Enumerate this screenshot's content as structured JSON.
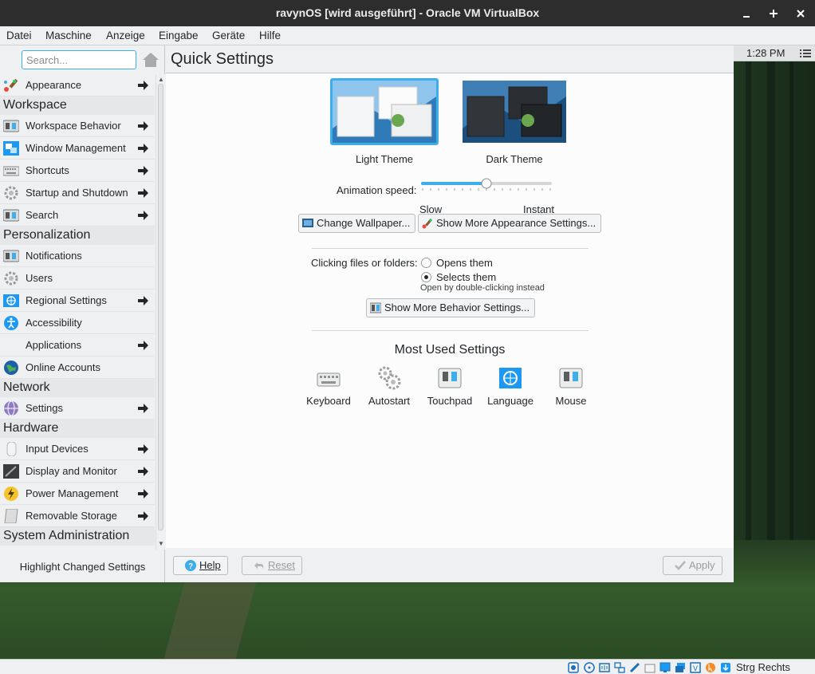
{
  "window": {
    "title": "ravynOS [wird ausgeführt] - Oracle VM VirtualBox",
    "controls": [
      "minimize-icon",
      "maximize-icon",
      "close-icon"
    ]
  },
  "menubar": [
    "Datei",
    "Maschine",
    "Anzeige",
    "Eingabe",
    "Geräte",
    "Hilfe"
  ],
  "panel": {
    "clock": "1:28 PM"
  },
  "sidebar": {
    "search_placeholder": "Search...",
    "items": [
      {
        "label": "Appearance",
        "icon": "appearance-icon",
        "arrow": true
      },
      {
        "header": "Workspace"
      },
      {
        "label": "Workspace Behavior",
        "icon": "workspace-behavior-icon",
        "arrow": true
      },
      {
        "label": "Window Management",
        "icon": "window-management-icon",
        "arrow": true
      },
      {
        "label": "Shortcuts",
        "icon": "keyboard-icon",
        "arrow": true
      },
      {
        "label": "Startup and Shutdown",
        "icon": "gear-icon",
        "arrow": true
      },
      {
        "label": "Search",
        "icon": "search-settings-icon",
        "arrow": true
      },
      {
        "header": "Personalization"
      },
      {
        "label": "Notifications",
        "icon": "notifications-icon",
        "arrow": false
      },
      {
        "label": "Users",
        "icon": "gear-icon",
        "arrow": false
      },
      {
        "label": "Regional Settings",
        "icon": "regional-icon",
        "arrow": true
      },
      {
        "label": "Accessibility",
        "icon": "accessibility-icon",
        "arrow": false
      },
      {
        "label": "Applications",
        "icon": "",
        "arrow": true
      },
      {
        "label": "Online Accounts",
        "icon": "globe-icon",
        "arrow": false
      },
      {
        "header": "Network"
      },
      {
        "label": "Settings",
        "icon": "network-settings-icon",
        "arrow": true
      },
      {
        "header": "Hardware"
      },
      {
        "label": "Input Devices",
        "icon": "mouse-icon",
        "arrow": true
      },
      {
        "label": "Display and Monitor",
        "icon": "monitor-icon",
        "arrow": true
      },
      {
        "label": "Power Management",
        "icon": "power-icon",
        "arrow": true
      },
      {
        "label": "Removable Storage",
        "icon": "storage-icon",
        "arrow": true
      },
      {
        "header": "System Administration"
      }
    ],
    "highlight_label": "Highlight Changed Settings"
  },
  "main": {
    "title": "Quick Settings",
    "themes": [
      {
        "label": "Light Theme",
        "selected": true
      },
      {
        "label": "Dark Theme",
        "selected": false
      }
    ],
    "animation": {
      "label": "Animation speed:",
      "slow": "Slow",
      "instant": "Instant",
      "level": 0.5
    },
    "change_wallpaper": "Change Wallpaper...",
    "more_appearance": "Show More Appearance Settings...",
    "clicking_label": "Clicking files or folders:",
    "radio_opens": "Opens them",
    "radio_selects": "Selects them",
    "radio_selected": "selects",
    "hint": "Open by double-clicking instead",
    "more_behavior": "Show More Behavior Settings...",
    "most_used_title": "Most Used Settings",
    "most_used": [
      {
        "label": "Keyboard",
        "icon": "keyboard-icon"
      },
      {
        "label": "Autostart",
        "icon": "gears-icon"
      },
      {
        "label": "Touchpad",
        "icon": "touchpad-icon"
      },
      {
        "label": "Language",
        "icon": "language-icon"
      },
      {
        "label": "Mouse",
        "icon": "mouse-settings-icon"
      }
    ]
  },
  "footer": {
    "help": "Help",
    "reset": "Reset",
    "apply": "Apply"
  },
  "statusbar": {
    "hostkey": "Strg Rechts"
  },
  "colors": {
    "accent": "#3daee9",
    "window_bg": "#eff0f1",
    "titlebar": "#2d2d2d"
  }
}
